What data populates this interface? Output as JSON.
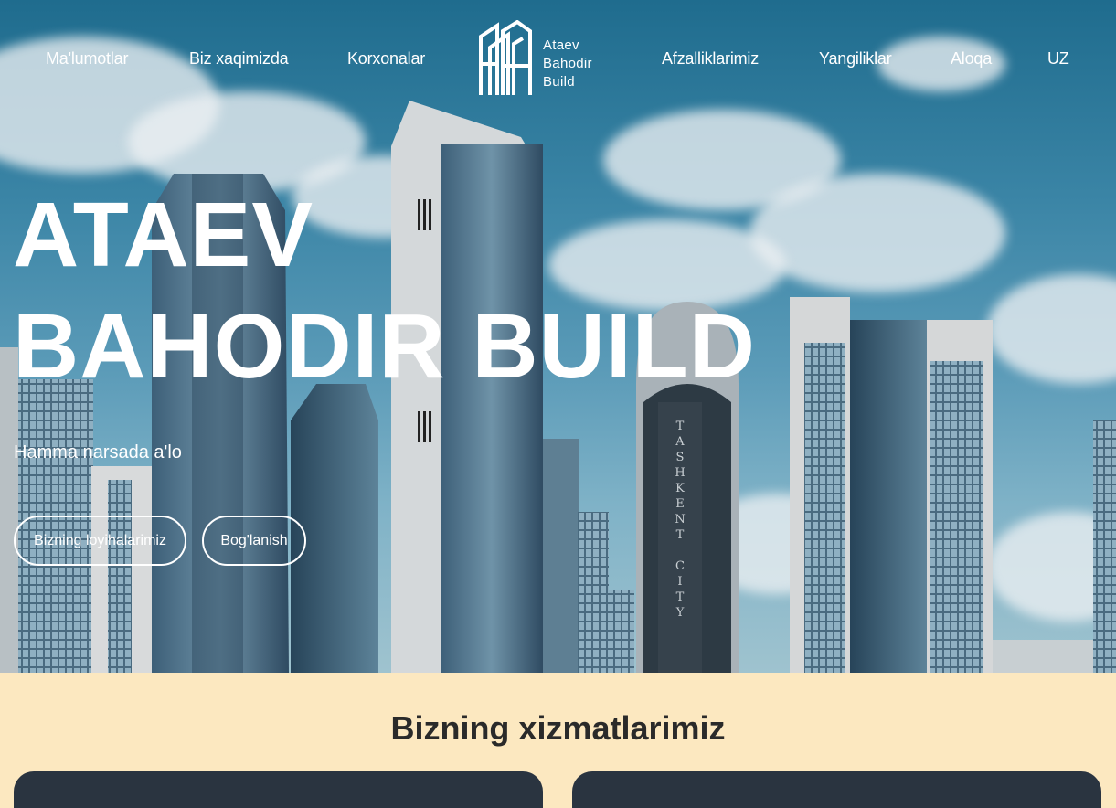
{
  "nav": {
    "items": [
      "Ma'lumotlar",
      "Biz xaqimizda",
      "Korxonalar",
      "Afzalliklarimiz",
      "Yangiliklar",
      "Aloqa"
    ],
    "lang": "UZ"
  },
  "logo": {
    "line1": "Ataev",
    "line2": "Bahodir",
    "line3": "Build"
  },
  "hero": {
    "title_line1": "ATAEV",
    "title_line2": "BAHODIR BUILD",
    "subtitle": "Hamma narsada a'lo",
    "btn_projects": "Bizning loyihalarimiz",
    "btn_contact": "Bog'lanish",
    "tower_sign": "TASHKENT CITY"
  },
  "services": {
    "title": "Bizning xizmatlarimiz"
  },
  "colors": {
    "cream": "#fce8c0",
    "dark_card": "#2a3440",
    "sky": "#2f7aa0"
  }
}
